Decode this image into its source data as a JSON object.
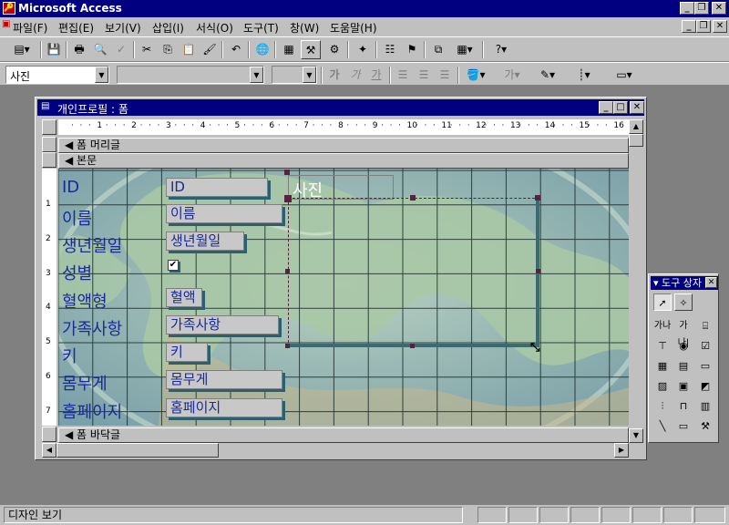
{
  "app": {
    "title": "Microsoft Access"
  },
  "menu": [
    "파일(F)",
    "편집(E)",
    "보기(V)",
    "삽입(I)",
    "서식(O)",
    "도구(T)",
    "창(W)",
    "도움말(H)"
  ],
  "format_toolbar": {
    "object_combo": "사진",
    "font_combo": "",
    "size_combo": "",
    "bold": "가",
    "italic": "가",
    "underline": "가"
  },
  "form": {
    "title": "개인프로필 : 폼",
    "ruler_numbers": [
      "1",
      "2",
      "3",
      "4",
      "5",
      "6",
      "7",
      "8",
      "9",
      "10",
      "11",
      "12",
      "13",
      "14",
      "15",
      "16"
    ],
    "vruler_numbers": [
      "1",
      "2",
      "3",
      "4",
      "5",
      "6",
      "7"
    ],
    "sections": {
      "header": "폼 머리글",
      "detail": "본문",
      "footer": "폼 바닥글"
    },
    "labels": [
      "ID",
      "이름",
      "생년월일",
      "성별",
      "혈액형",
      "가족사항",
      "키",
      "몸무게",
      "홈페이지"
    ],
    "fields": [
      "ID",
      "이름",
      "생년월일",
      "",
      "혈액",
      "가족사항",
      "키",
      "몸무게",
      "홈페이지"
    ],
    "photo_label": "사진"
  },
  "toolbox": {
    "title": "도구 상자",
    "tools": [
      "select-tool",
      "wizard-tool",
      "label-tool",
      "textbox-tool",
      "option-group-tool",
      "toggle-tool",
      "option-button-tool",
      "checkbox-tool",
      "combo-tool",
      "list-tool",
      "command-button-tool",
      "image-tool",
      "unbound-object-tool",
      "bound-object-tool",
      "page-break-tool",
      "tab-control-tool",
      "subform-tool",
      "line-tool",
      "rectangle-tool",
      "more-tools"
    ],
    "label_text": "가나",
    "textbox_text": "가나|"
  },
  "status": {
    "text": "디자인 보기"
  },
  "colors": {
    "title_bg": "#000080",
    "grid_line": "#1a2a2a",
    "label_text": "#1a2a9a",
    "selection": "#5a2040"
  }
}
